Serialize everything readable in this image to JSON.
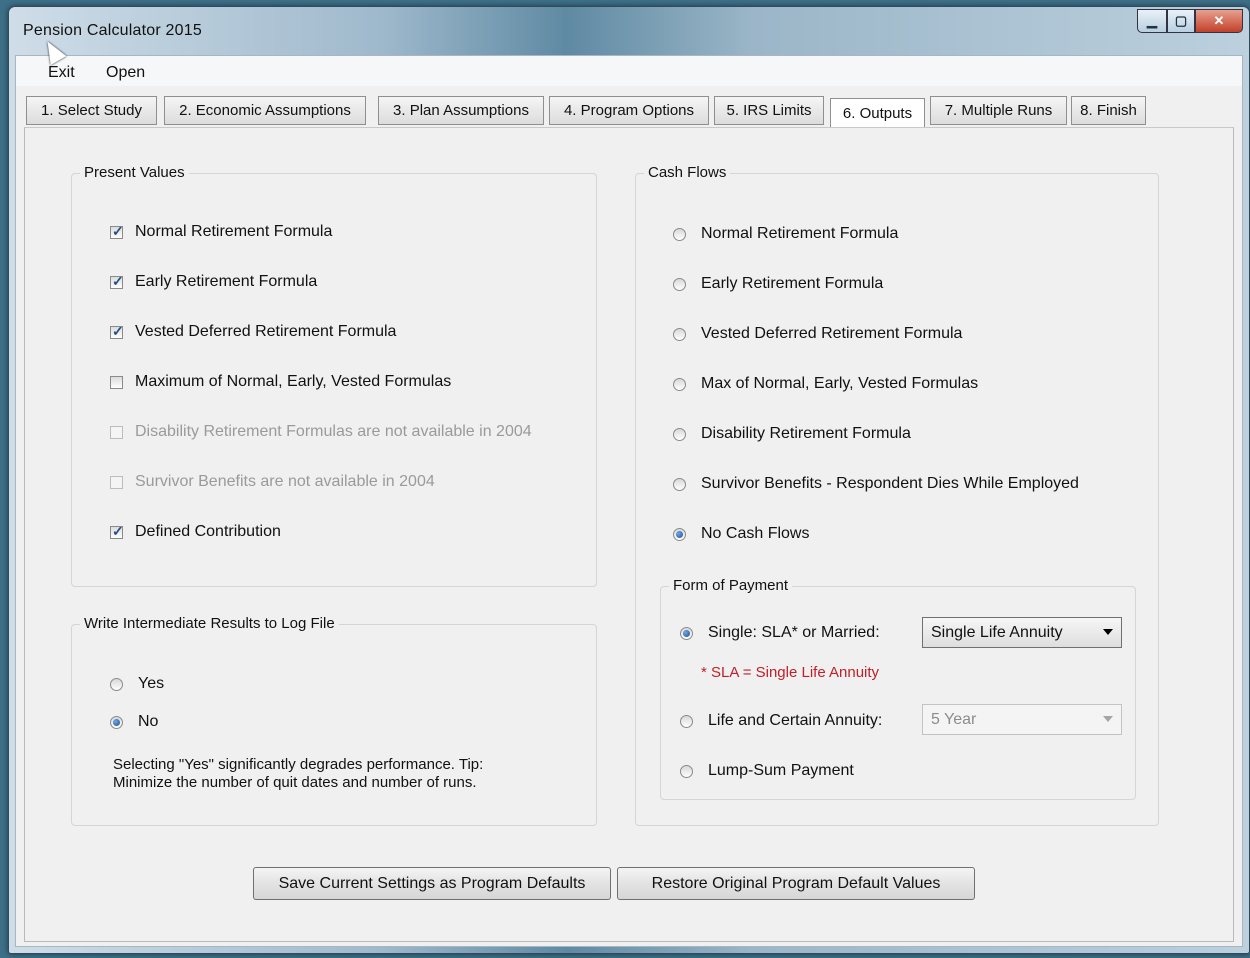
{
  "window": {
    "title": "Pension Calculator 2015"
  },
  "menu": {
    "exit": "Exit",
    "open": "Open"
  },
  "tabs": [
    {
      "label": "1. Select Study"
    },
    {
      "label": "2. Economic Assumptions"
    },
    {
      "label": "3. Plan Assumptions"
    },
    {
      "label": "4. Program Options"
    },
    {
      "label": "5. IRS Limits"
    },
    {
      "label": "6. Outputs",
      "active": true
    },
    {
      "label": "7. Multiple Runs"
    },
    {
      "label": "8. Finish"
    }
  ],
  "present_values": {
    "title": "Present Values",
    "items": [
      {
        "label": "Normal Retirement Formula",
        "checked": true,
        "enabled": true
      },
      {
        "label": "Early Retirement Formula",
        "checked": true,
        "enabled": true
      },
      {
        "label": "Vested Deferred Retirement Formula",
        "checked": true,
        "enabled": true
      },
      {
        "label": "Maximum of Normal, Early, Vested Formulas",
        "checked": false,
        "enabled": true
      },
      {
        "label": "Disability Retirement Formulas are not available in 2004",
        "checked": false,
        "enabled": false
      },
      {
        "label": "Survivor Benefits are not available in 2004",
        "checked": false,
        "enabled": false
      },
      {
        "label": "Defined Contribution",
        "checked": true,
        "enabled": true
      }
    ]
  },
  "log_file": {
    "title": "Write Intermediate Results to Log File",
    "yes": "Yes",
    "no": "No",
    "selected": "No",
    "note_line1": "Selecting \"Yes\" significantly degrades performance.  Tip:",
    "note_line2": "Minimize the number of quit dates and number of runs."
  },
  "cash_flows": {
    "title": "Cash Flows",
    "items": [
      {
        "label": "Normal Retirement Formula",
        "selected": false
      },
      {
        "label": "Early Retirement Formula",
        "selected": false
      },
      {
        "label": "Vested Deferred Retirement Formula",
        "selected": false
      },
      {
        "label": "Max of Normal,  Early, Vested Formulas",
        "selected": false
      },
      {
        "label": "Disability Retirement Formula",
        "selected": false
      },
      {
        "label": "Survivor Benefits - Respondent Dies While Employed",
        "selected": false
      },
      {
        "label": "No Cash Flows",
        "selected": true
      }
    ]
  },
  "form_of_payment": {
    "title": "Form of Payment",
    "single_label": "Single: SLA* or Married:",
    "single_selected": true,
    "single_value": "Single Life Annuity",
    "sla_note": "* SLA = Single Life Annuity",
    "life_certain_label": "Life and Certain Annuity:",
    "life_certain_value": "5 Year",
    "lump_sum_label": "Lump-Sum Payment"
  },
  "buttons": {
    "save_defaults": "Save Current Settings as Program Defaults",
    "restore_defaults": "Restore Original Program Default Values"
  },
  "colors": {
    "accent": "#1b4f95",
    "note_red": "#c0202a",
    "desktop": "#3d6f88"
  }
}
